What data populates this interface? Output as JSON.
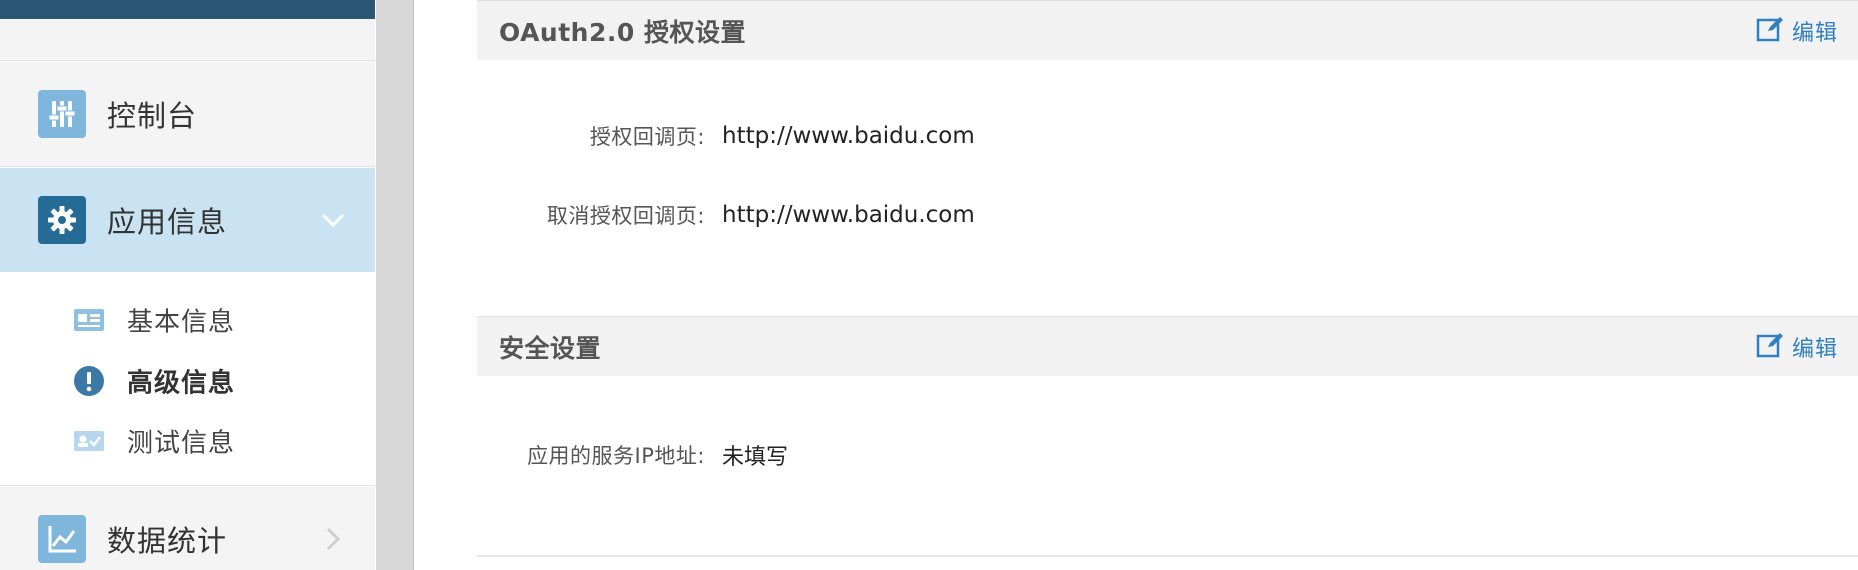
{
  "sidebar": {
    "items": [
      {
        "label": "控制台",
        "icon": "console-sliders-icon",
        "active": false
      },
      {
        "label": "应用信息",
        "icon": "gear-icon",
        "active": true
      },
      {
        "label": "数据统计",
        "icon": "line-chart-icon",
        "active": false
      }
    ],
    "sub_items": [
      {
        "label": "基本信息",
        "icon": "id-card-icon",
        "active": false
      },
      {
        "label": "高级信息",
        "icon": "exclamation-circle-icon",
        "active": true
      },
      {
        "label": "测试信息",
        "icon": "user-card-check-icon",
        "active": false
      }
    ]
  },
  "sections": {
    "oauth": {
      "title": "OAuth2.0 授权设置",
      "edit_label": "编辑",
      "fields": [
        {
          "label": "授权回调页:",
          "value": "http://www.baidu.com"
        },
        {
          "label": "取消授权回调页:",
          "value": "http://www.baidu.com"
        }
      ]
    },
    "security": {
      "title": "安全设置",
      "edit_label": "编辑",
      "fields": [
        {
          "label": "应用的服务IP地址:",
          "value": "未填写"
        }
      ]
    }
  },
  "colors": {
    "sidebar_active_bg": "#c9e3f2",
    "icon_dark": "#246b96",
    "icon_light": "#7fb7dc",
    "link": "#2f7fc1",
    "top_bar": "#2b5674"
  }
}
